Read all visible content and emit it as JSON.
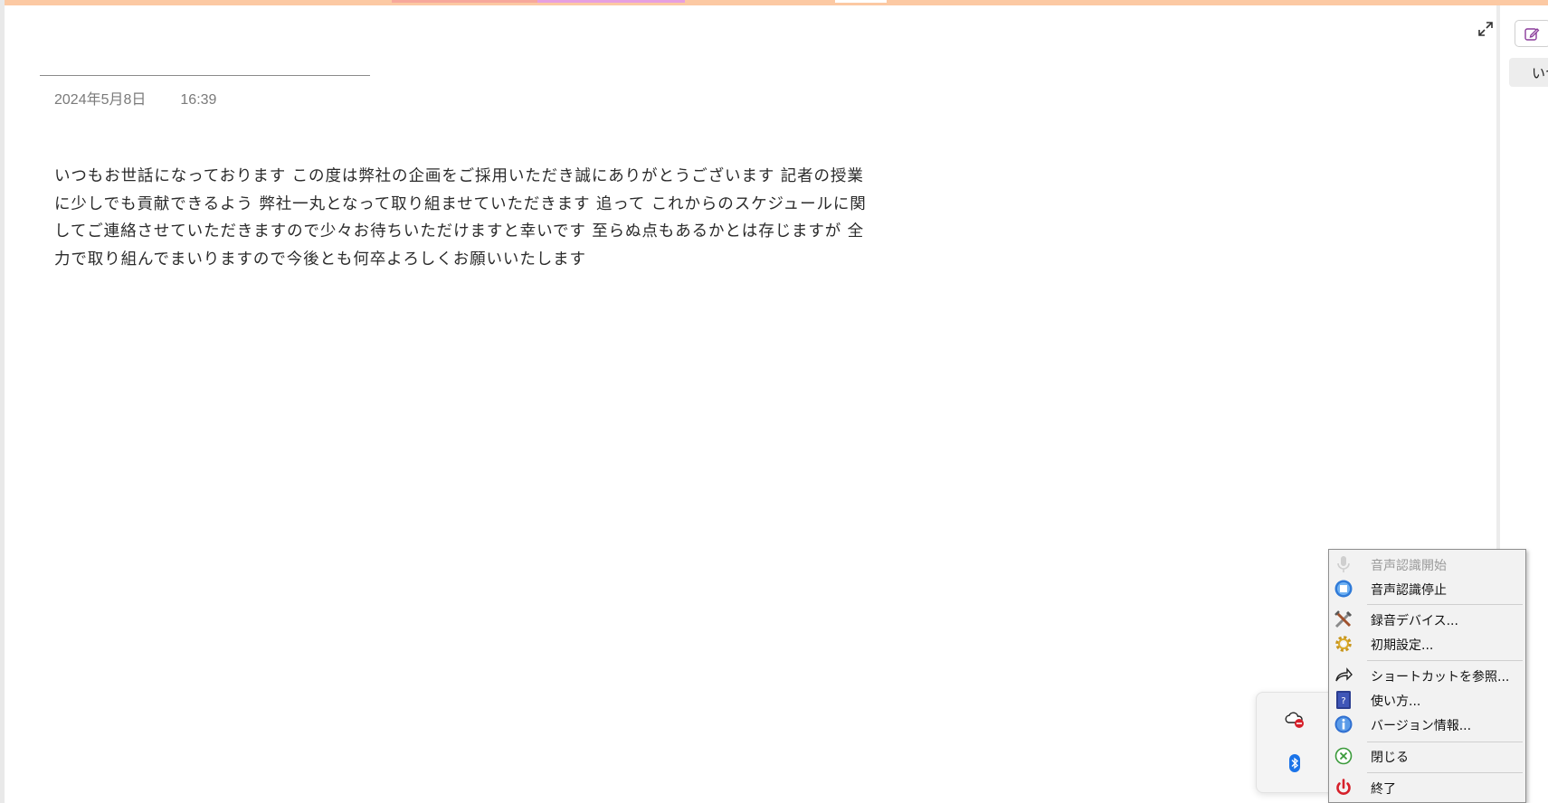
{
  "note": {
    "date": "2024年5月8日",
    "time": "16:39",
    "body": " いつもお世話になっております この度は弊社の企画をご採用いただき誠にありがとうございます 記者の授業に少しでも貢献できるよう 弊社一丸となって取り組ませていただきます 追って これからのスケジュールに関してご連絡させていただきますので少々お待ちいただけますと幸いです 至らぬ点もあるかとは存じますが 全力で取り組んでまいりますので今後とも何卒よろしくお願いいたします"
  },
  "right_panel": {
    "chip_label": "いつ"
  },
  "colors": {
    "top_strip": "#fcc9a3",
    "strip_segment_1": "#f7a89b",
    "strip_segment_2": "#e79fe0",
    "menu_background": "#f2f2f2"
  },
  "tray": {
    "icons": [
      "onedrive-offline-icon",
      "bluetooth-icon",
      "microphone-app-icon"
    ]
  },
  "context_menu": {
    "items": [
      {
        "label": "音声認識開始",
        "icon": "microphone-icon",
        "enabled": false
      },
      {
        "label": "音声認識停止",
        "icon": "stop-icon",
        "enabled": true
      },
      {
        "label": "録音デバイス...",
        "icon": "tools-icon",
        "enabled": true
      },
      {
        "label": "初期設定...",
        "icon": "gear-icon",
        "enabled": true
      },
      {
        "label": "ショートカットを参照...",
        "icon": "share-arrow-icon",
        "enabled": true
      },
      {
        "label": "使い方...",
        "icon": "help-book-icon",
        "enabled": true
      },
      {
        "label": "バージョン情報...",
        "icon": "info-icon",
        "enabled": true
      },
      {
        "label": "閉じる",
        "icon": "close-circle-icon",
        "enabled": true
      },
      {
        "label": "終了",
        "icon": "power-icon",
        "enabled": true
      }
    ]
  }
}
